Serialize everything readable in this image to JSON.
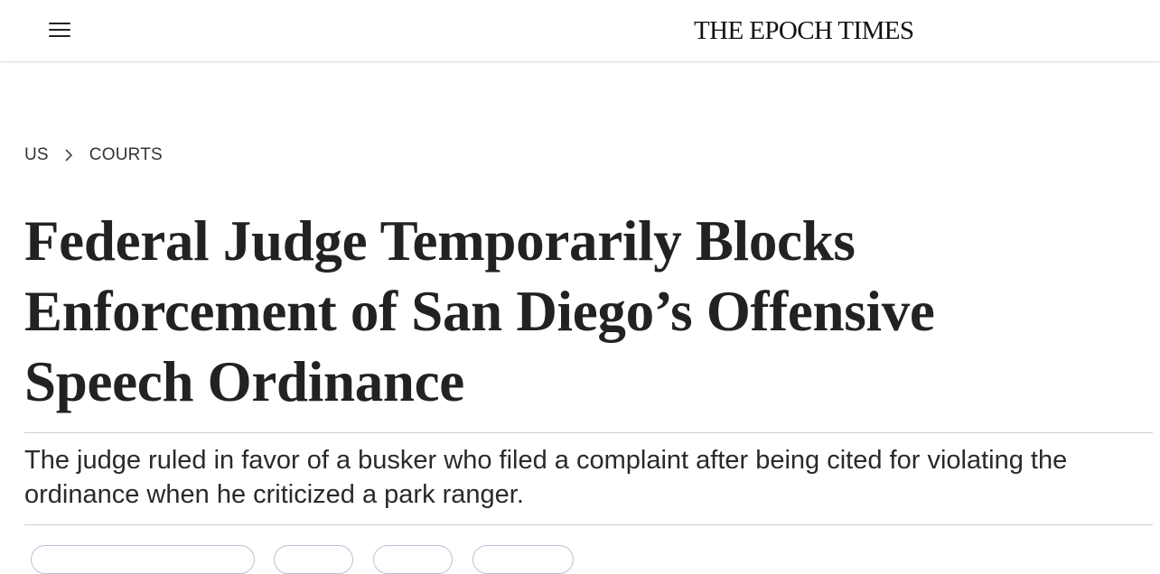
{
  "header": {
    "menu_icon": "hamburger-menu-icon",
    "logo_text": "THE EPOCH TIMES"
  },
  "breadcrumb": {
    "items": [
      "US",
      "COURTS"
    ],
    "separator_icon": "chevron-right-icon"
  },
  "article": {
    "title": "Federal Judge Temporarily Blocks Enforcement of San Diego’s Offensive Speech Ordinance",
    "subtitle": "The judge ruled in favor of a busker who filed a complaint after being cited for violating the ordinance when he criticized a park ranger."
  },
  "colors": {
    "headline": "#222222",
    "rule": "#cfcfcf",
    "pill_border": "#b9c3d3"
  }
}
